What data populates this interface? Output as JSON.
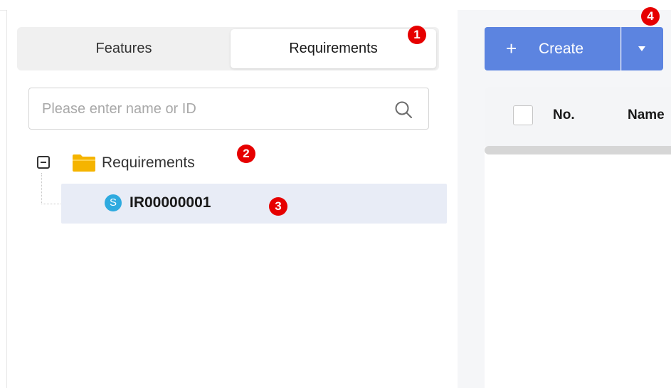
{
  "tabs": {
    "features_label": "Features",
    "requirements_label": "Requirements"
  },
  "search": {
    "placeholder": "Please enter name or ID",
    "value": ""
  },
  "tree": {
    "root_label": "Requirements",
    "child_icon_letter": "S",
    "child_label": "IR00000001"
  },
  "badges": [
    "1",
    "2",
    "3",
    "4"
  ],
  "toolbar": {
    "create_plus": "+",
    "create_label": "Create"
  },
  "table": {
    "columns": [
      "No.",
      "Name"
    ]
  },
  "colors": {
    "accent": "#5c84e0",
    "selected_row": "#e8ecf6",
    "badge": "#e60000",
    "folder": "#f5b400",
    "s_icon": "#2eaadf"
  }
}
